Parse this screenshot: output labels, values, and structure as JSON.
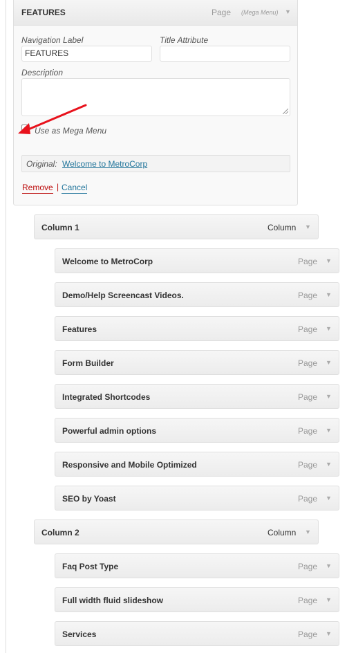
{
  "expanded_item": {
    "title": "FEATURES",
    "type": "Page",
    "type_extra": "(Mega Menu)",
    "nav_label_caption": "Navigation Label",
    "nav_label_value": "FEATURES",
    "title_attr_caption": "Title Attribute",
    "title_attr_value": "",
    "description_caption": "Description",
    "description_value": "",
    "mega_menu_label": "Use as Mega Menu",
    "mega_menu_checked": true,
    "original_label": "Original:",
    "original_link": "Welcome to MetroCorp",
    "remove_label": "Remove",
    "separator": "|",
    "cancel_label": "Cancel"
  },
  "menu_items": [
    {
      "title": "Column 1",
      "type": "Column"
    },
    {
      "title": "Welcome to MetroCorp",
      "type": "Page"
    },
    {
      "title": "Demo/Help Screencast Videos.",
      "type": "Page"
    },
    {
      "title": "Features",
      "type": "Page"
    },
    {
      "title": "Form Builder",
      "type": "Page"
    },
    {
      "title": "Integrated Shortcodes",
      "type": "Page"
    },
    {
      "title": "Powerful admin options",
      "type": "Page"
    },
    {
      "title": "Responsive and Mobile Optimized",
      "type": "Page"
    },
    {
      "title": "SEO by Yoast",
      "type": "Page"
    },
    {
      "title": "Column 2",
      "type": "Column"
    },
    {
      "title": "Faq Post Type",
      "type": "Page"
    },
    {
      "title": "Full width fluid slideshow",
      "type": "Page"
    },
    {
      "title": "Services",
      "type": "Page"
    }
  ],
  "icons": {
    "expand_arrow": "▼",
    "check": "✓"
  },
  "colors": {
    "annotation_arrow": "#e8121c",
    "link": "#21759b",
    "remove": "#bc0b0b"
  }
}
